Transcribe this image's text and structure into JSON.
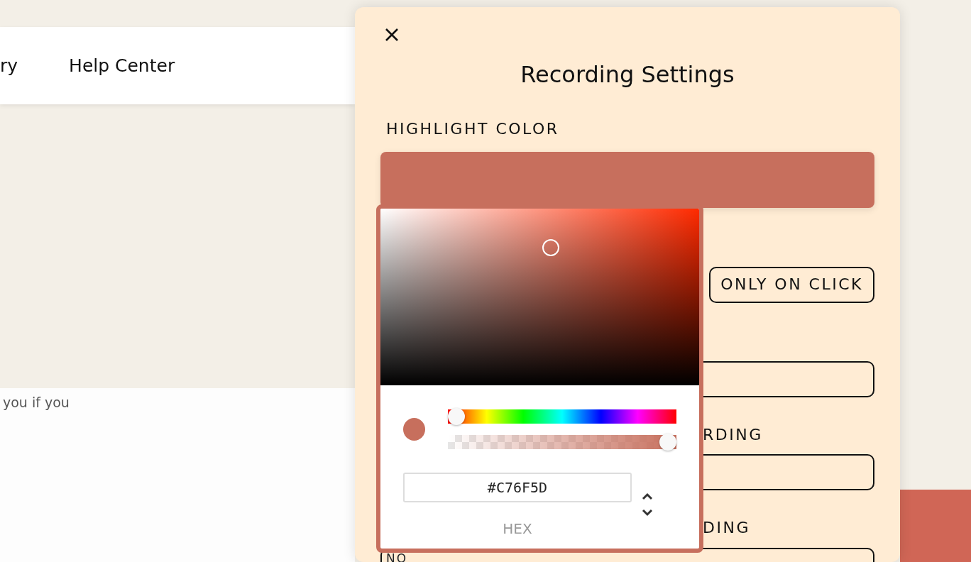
{
  "background_page": {
    "nav_links": [
      "ry",
      "Help Center"
    ],
    "content_text": "you if you"
  },
  "settings_panel": {
    "title": "Recording Settings",
    "highlight_color_label": "HIGHLIGHT COLOR",
    "option_button": "ONLY ON CLICK",
    "fields": [
      {
        "label": "RDING"
      },
      {
        "label": "DING",
        "value": "NO"
      }
    ]
  },
  "color_picker": {
    "hue_slider": {
      "level": 0
    },
    "alpha_slider": {
      "level": 1
    },
    "hex_value": "#C76F5D",
    "format_label": "HEX"
  }
}
